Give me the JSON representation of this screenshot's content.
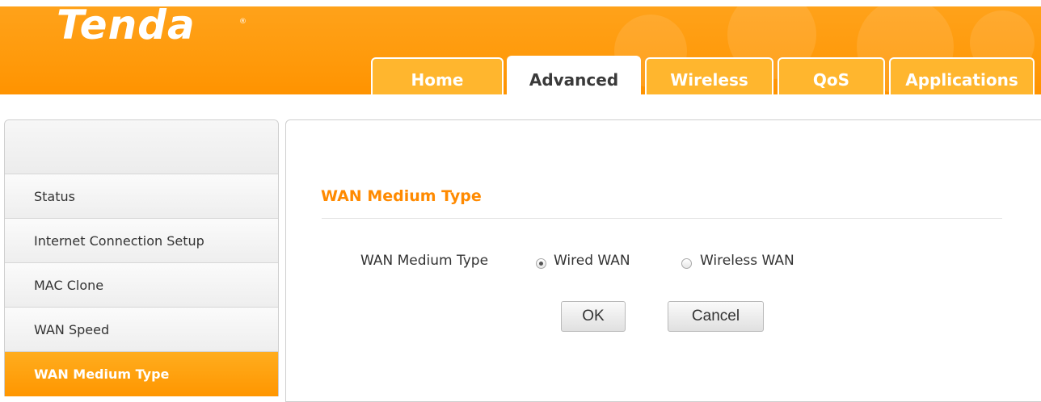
{
  "brand": {
    "logo_text": "Tenda",
    "reg_mark": "®"
  },
  "tabs": [
    {
      "label": "Home",
      "active": false
    },
    {
      "label": "Advanced",
      "active": true
    },
    {
      "label": "Wireless",
      "active": false
    },
    {
      "label": "QoS",
      "active": false
    },
    {
      "label": "Applications",
      "active": false
    }
  ],
  "sidebar": {
    "items": [
      {
        "label": "Status"
      },
      {
        "label": "Internet Connection Setup"
      },
      {
        "label": "MAC Clone"
      },
      {
        "label": "WAN Speed"
      },
      {
        "label": "WAN Medium Type",
        "active": true
      }
    ]
  },
  "main": {
    "section_title": "WAN Medium Type",
    "field_label": "WAN Medium Type",
    "options": [
      {
        "label": "Wired WAN",
        "checked": true
      },
      {
        "label": "Wireless WAN",
        "checked": false
      }
    ],
    "ok_label": "OK",
    "cancel_label": "Cancel"
  },
  "colors": {
    "accent": "#ff9a0b",
    "title": "#ff8a00"
  }
}
